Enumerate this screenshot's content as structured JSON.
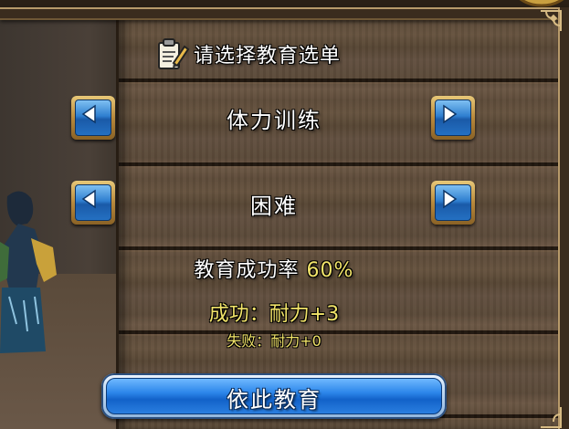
{
  "dialog": {
    "title": "请选择教育选单",
    "menu_option": "体力训练",
    "difficulty_option": "困难",
    "success_rate_label": "教育成功率",
    "success_rate_value": "60%",
    "success_result": "成功：耐力+3",
    "fail_result": "失败：耐力+0",
    "confirm_label": "依此教育"
  },
  "icons": {
    "title_icon": "notepad-pencil-icon",
    "prev_icon": "arrow-left-icon",
    "next_icon": "arrow-right-icon",
    "corner_icon": "frame-corner-ornament-icon"
  },
  "colors": {
    "highlight_text": "#f2e46a",
    "button_blue": "#2c86ea",
    "panel_wood": "#5f4d3b"
  }
}
